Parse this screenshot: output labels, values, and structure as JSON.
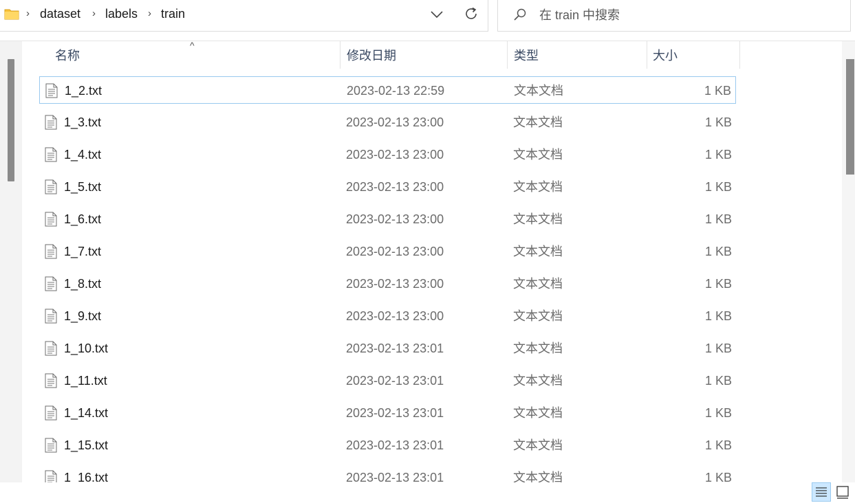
{
  "address": {
    "breadcrumbs": [
      "dataset",
      "labels",
      "train"
    ]
  },
  "search": {
    "placeholder": "在 train 中搜索"
  },
  "columns": {
    "name": "名称",
    "date": "修改日期",
    "type": "类型",
    "size": "大小"
  },
  "files": [
    {
      "name": "1_2.txt",
      "date": "2023-02-13 22:59",
      "type": "文本文档",
      "size": "1 KB"
    },
    {
      "name": "1_3.txt",
      "date": "2023-02-13 23:00",
      "type": "文本文档",
      "size": "1 KB"
    },
    {
      "name": "1_4.txt",
      "date": "2023-02-13 23:00",
      "type": "文本文档",
      "size": "1 KB"
    },
    {
      "name": "1_5.txt",
      "date": "2023-02-13 23:00",
      "type": "文本文档",
      "size": "1 KB"
    },
    {
      "name": "1_6.txt",
      "date": "2023-02-13 23:00",
      "type": "文本文档",
      "size": "1 KB"
    },
    {
      "name": "1_7.txt",
      "date": "2023-02-13 23:00",
      "type": "文本文档",
      "size": "1 KB"
    },
    {
      "name": "1_8.txt",
      "date": "2023-02-13 23:00",
      "type": "文本文档",
      "size": "1 KB"
    },
    {
      "name": "1_9.txt",
      "date": "2023-02-13 23:00",
      "type": "文本文档",
      "size": "1 KB"
    },
    {
      "name": "1_10.txt",
      "date": "2023-02-13 23:01",
      "type": "文本文档",
      "size": "1 KB"
    },
    {
      "name": "1_11.txt",
      "date": "2023-02-13 23:01",
      "type": "文本文档",
      "size": "1 KB"
    },
    {
      "name": "1_14.txt",
      "date": "2023-02-13 23:01",
      "type": "文本文档",
      "size": "1 KB"
    },
    {
      "name": "1_15.txt",
      "date": "2023-02-13 23:01",
      "type": "文本文档",
      "size": "1 KB"
    },
    {
      "name": "1_16.txt",
      "date": "2023-02-13 23:01",
      "type": "文本文档",
      "size": "1 KB"
    }
  ],
  "icons": {
    "folder": "folder-icon",
    "file": "text-file-icon",
    "search": "search-icon",
    "refresh": "refresh-icon",
    "dropdown": "chevron-down-icon",
    "details_view": "details-view-icon",
    "tiles_view": "large-icons-view-icon"
  },
  "colors": {
    "folder_yellow": "#f8c33a",
    "selection_border": "#99c9ef",
    "header_text": "#3b4a63",
    "scrollbar_thumb": "#8a8a8a"
  }
}
